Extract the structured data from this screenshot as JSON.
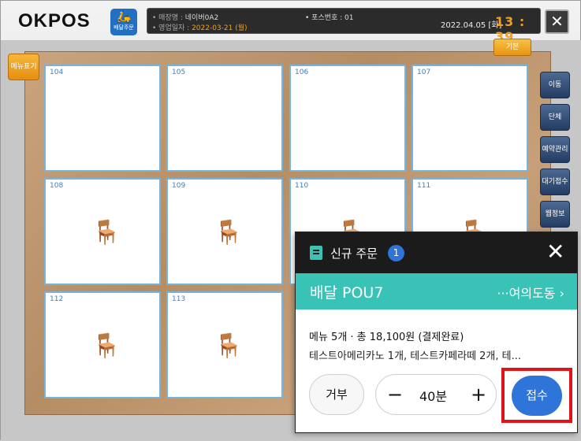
{
  "header": {
    "logo": "OKPOS",
    "delivery_button_label": "배달주문",
    "store_key": "• 매장명 :",
    "store_name": "네이버0A2",
    "business_date_key": "• 영업일자 :",
    "business_date": "2022-03-21 (월)",
    "pos_no": "• 포스번호 : 01",
    "date": "2022.04.05 [화]",
    "time": "13 : 39",
    "close_symbol": "✕"
  },
  "floor": {
    "menu_toggle_label": "메뉴표기",
    "basic_label": "기본",
    "tables": [
      {
        "num": "104",
        "chairs": false
      },
      {
        "num": "105",
        "chairs": false
      },
      {
        "num": "106",
        "chairs": false
      },
      {
        "num": "107",
        "chairs": false
      },
      {
        "num": "108",
        "chairs": true
      },
      {
        "num": "109",
        "chairs": true
      },
      {
        "num": "110",
        "chairs": true
      },
      {
        "num": "111",
        "chairs": true
      },
      {
        "num": "112",
        "chairs": true
      },
      {
        "num": "113",
        "chairs": true
      }
    ]
  },
  "side_menu": [
    "이동",
    "단체",
    "예약관리",
    "대기접수",
    "웹정보"
  ],
  "popup": {
    "title": "신규 주문",
    "badge": "1",
    "close_symbol": "✕",
    "delivery_type": "배달 POU7",
    "area": "···여의도동 ›",
    "summary": "메뉴 5개 · 총 18,100원 (결제완료)",
    "items": "테스트아메리카노 1개, 테스트카페라떼 2개, 테...",
    "reject_label": "거부",
    "minus": "−",
    "time_value": "40분",
    "plus": "+",
    "accept_label": "접수"
  },
  "colors": {
    "accent_teal": "#39c2b6",
    "accept_blue": "#2f74d8",
    "highlight_red": "#e0121a"
  }
}
